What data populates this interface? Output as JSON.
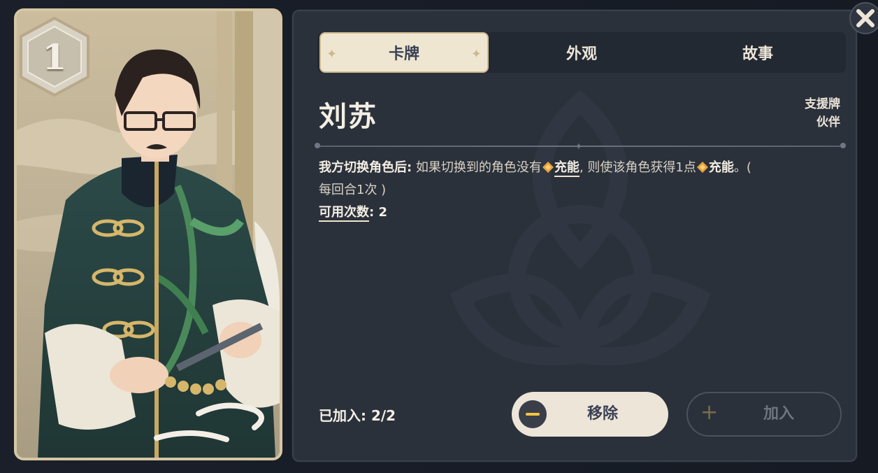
{
  "card": {
    "cost": "1"
  },
  "tabs": [
    {
      "label": "卡牌",
      "active": true
    },
    {
      "label": "外观",
      "active": false
    },
    {
      "label": "故事",
      "active": false
    }
  ],
  "detail": {
    "name": "刘苏",
    "tags": [
      "支援牌",
      "伙伴"
    ],
    "description": {
      "trigger": "我方切换角色后:",
      "text_before": " 如果切换到的角色没有",
      "keyword_1": "充能",
      "text_middle": ", 则使该角色获得1点",
      "keyword_2": "充能",
      "text_after": "。(",
      "limit": "每回合1次 )",
      "usage_label": "可用次数",
      "usage_value": ": 2"
    },
    "added_status": "已加入: 2/2"
  },
  "buttons": {
    "remove_label": "移除",
    "add_label": "加入"
  },
  "colors": {
    "panel_bg": "#2b313b",
    "tab_active_bg": "#efe6d2",
    "energy_icon": "#e8a33a",
    "accent_gold": "#cdb98f"
  }
}
